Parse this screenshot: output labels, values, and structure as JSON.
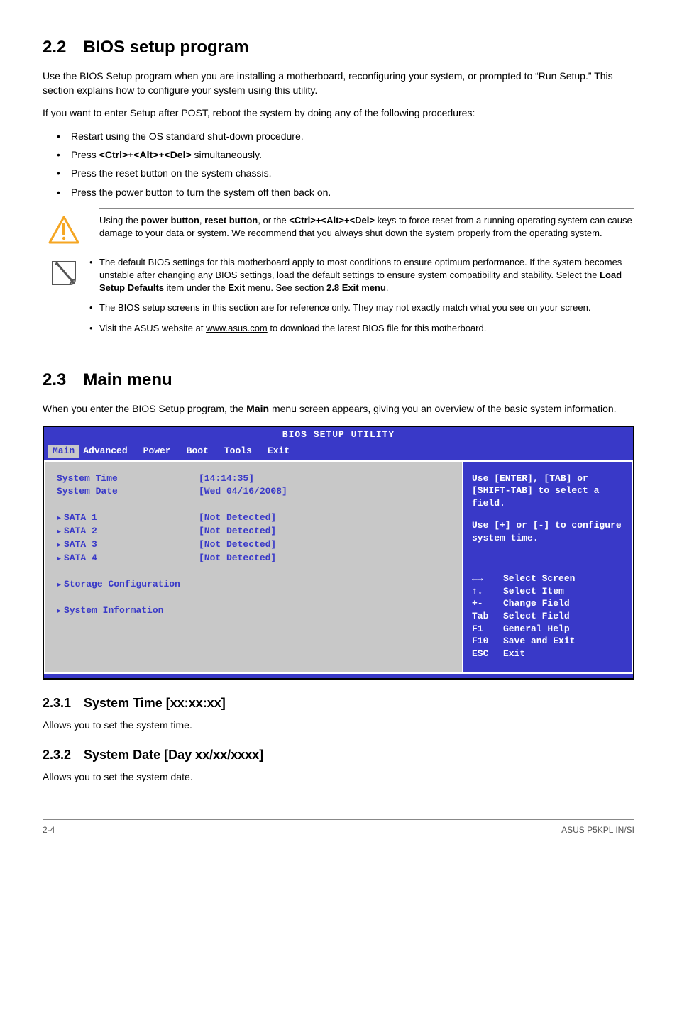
{
  "section22": {
    "heading": "2.2 BIOS setup program",
    "p1": "Use the BIOS Setup program when you are installing a motherboard, reconfiguring your system, or prompted to “Run Setup.” This section explains how to configure your system using this utility.",
    "p2": "If you want to enter Setup after POST, reboot the system by doing any of the following procedures:",
    "bullets": {
      "b1": "Restart using the OS standard shut-down procedure.",
      "b2_pre": "Press ",
      "b2_bold": "<Ctrl>+<Alt>+<Del>",
      "b2_post": " simultaneously.",
      "b3": "Press the reset button on the system chassis.",
      "b4": "Press the power button to turn the system off then back on."
    },
    "warn": {
      "pre": "Using the ",
      "b1": "power button",
      "mid1": ", ",
      "b2": "reset button",
      "mid2": ", or the ",
      "b3": "<Ctrl>+<Alt>+<Del>",
      "post": " keys to force reset from a running operating system can cause damage to your data or system. We recommend that you always shut down the system properly from the operating system."
    },
    "note": {
      "n1_pre": "The default BIOS settings for this motherboard apply to most conditions to ensure optimum performance. If the system becomes unstable after changing any BIOS settings, load the default settings to ensure system compatibility and stability. Select the ",
      "n1_b1": "Load Setup Defaults",
      "n1_mid": " item under the ",
      "n1_b2": "Exit",
      "n1_mid2": " menu. See section ",
      "n1_b3": "2.8 Exit menu",
      "n1_post": ".",
      "n2": "The BIOS setup screens in this section are for reference only. They may not exactly match what you see on your screen.",
      "n3_pre": "Visit the ASUS website at ",
      "n3_link": "www.asus.com",
      "n3_post": " to download the latest BIOS file for this motherboard."
    }
  },
  "section23": {
    "heading": "2.3 Main menu",
    "p1_pre": "When you enter the BIOS Setup program, the ",
    "p1_b": "Main",
    "p1_post": " menu screen appears, giving you an overview of the basic system information."
  },
  "bios": {
    "title": "BIOS SETUP UTILITY",
    "tabs": {
      "t1": "Main",
      "t2": "Advanced",
      "t3": "Power",
      "t4": "Boot",
      "t5": "Tools",
      "t6": "Exit"
    },
    "left": {
      "time_label": "System Time",
      "time_value": "[14:14:35]",
      "date_label": "System Date",
      "date_value": "[Wed 04/16/2008]",
      "sata1_label": "SATA 1",
      "sata1_value": "[Not Detected]",
      "sata2_label": "SATA 2",
      "sata2_value": "[Not Detected]",
      "sata3_label": "SATA 3",
      "sata3_value": "[Not Detected]",
      "sata4_label": "SATA 4",
      "sata4_value": "[Not Detected]",
      "storage": "Storage Configuration",
      "sysinfo": "System Information"
    },
    "right": {
      "help1": "Use [ENTER], [TAB] or [SHIFT-TAB] to select a field.",
      "help2": "Use [+] or [-] to configure system time.",
      "k_arrow_lr": "←→",
      "v_arrow_lr": "Select Screen",
      "k_arrow_ud": "↑↓",
      "v_arrow_ud": "Select Item",
      "k_pm": "+-",
      "v_pm": "Change Field",
      "k_tab": "Tab",
      "v_tab": "Select Field",
      "k_f1": "F1",
      "v_f1": "General Help",
      "k_f10": "F10",
      "v_f10": "Save and Exit",
      "k_esc": "ESC",
      "v_esc": "Exit"
    }
  },
  "sub231": {
    "heading": "2.3.1 System Time [xx:xx:xx]",
    "p": "Allows you to set the system time."
  },
  "sub232": {
    "heading": "2.3.2 System Date [Day xx/xx/xxxx]",
    "p": "Allows you to set the system date."
  },
  "footer": {
    "left": "2-4",
    "right": "ASUS P5KPL IN/SI"
  }
}
